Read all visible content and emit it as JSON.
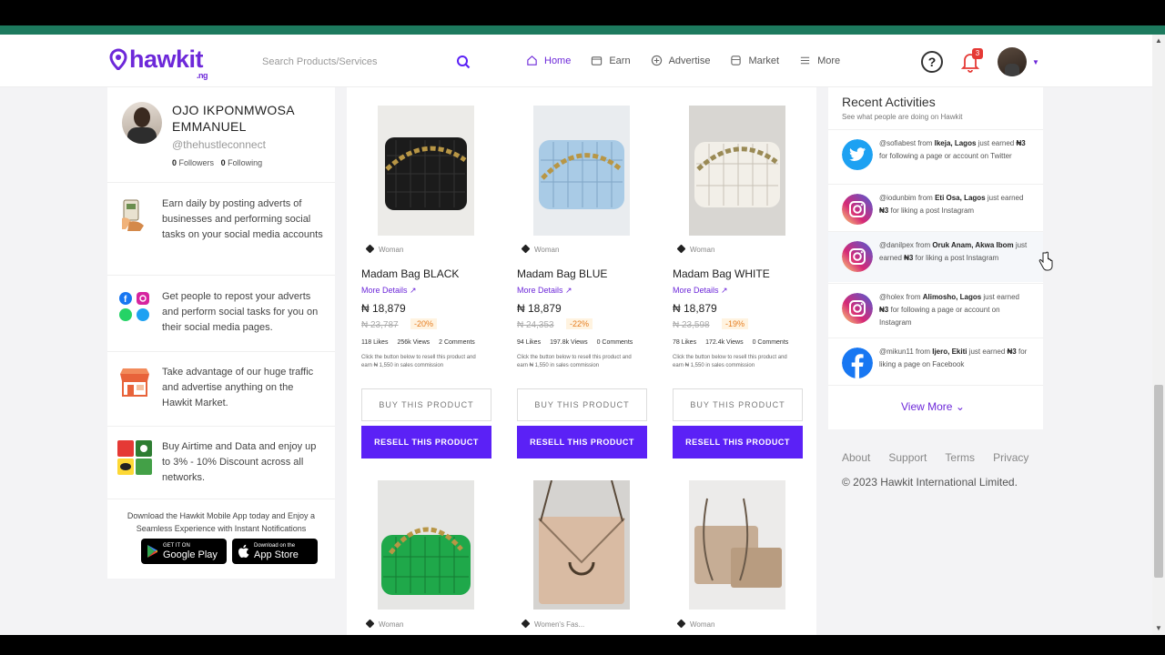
{
  "header": {
    "logo_text": "hawkit",
    "logo_suffix": ".ng",
    "search_placeholder": "Search Products/Services",
    "nav": [
      {
        "label": "Home",
        "icon": "home-icon"
      },
      {
        "label": "Earn",
        "icon": "wallet-icon"
      },
      {
        "label": "Advertise",
        "icon": "plus-circle-icon"
      },
      {
        "label": "Market",
        "icon": "store-icon"
      },
      {
        "label": "More",
        "icon": "menu-icon"
      }
    ],
    "help_label": "?",
    "notification_count": "3"
  },
  "profile": {
    "name": "OJO IKPONMWOSA EMMANUEL",
    "handle": "@thehustleconnect",
    "followers": "0",
    "followers_label": "Followers",
    "following": "0",
    "following_label": "Following"
  },
  "features": [
    {
      "text": "Earn daily by posting adverts of businesses and performing social tasks on your social media accounts",
      "icon": "money-hand-icon"
    },
    {
      "text": "Get people to repost your adverts and perform social tasks for you on their social media pages.",
      "icon": "social-icons"
    },
    {
      "text": "Take advantage of our huge traffic and advertise anything on the Hawkit Market.",
      "icon": "shop-icon"
    },
    {
      "text": "Buy Airtime and Data and enjoy up to 3% - 10% Discount across all networks.",
      "icon": "network-logos-icon"
    }
  ],
  "download": {
    "text": "Download the Hawkit Mobile App today and Enjoy a Seamless Experience with Instant Notifications",
    "google_small": "GET IT ON",
    "google_large": "Google Play",
    "apple_small": "Download on the",
    "apple_large": "App Store"
  },
  "product_labels": {
    "more_details": "More Details",
    "buy": "BUY THIS PRODUCT",
    "resell": "RESELL THIS PRODUCT",
    "note": "Click the button below to resell this product and earn ₦ 1,550 in sales commission"
  },
  "products": [
    {
      "category": "Woman",
      "title": "Madam Bag BLACK",
      "price": "₦ 18,879",
      "old_price": "₦ 23,787",
      "discount": "-20%",
      "likes": "118 Likes",
      "views": "256k Views",
      "comments": "2 Comments",
      "color": "#1b1b1b"
    },
    {
      "category": "Woman",
      "title": "Madam Bag BLUE",
      "price": "₦ 18,879",
      "old_price": "₦ 24,353",
      "discount": "-22%",
      "likes": "94 Likes",
      "views": "197.8k Views",
      "comments": "0 Comments",
      "color": "#a9cbe6"
    },
    {
      "category": "Woman",
      "title": "Madam Bag WHITE",
      "price": "₦ 18,879",
      "old_price": "₦ 23,598",
      "discount": "-19%",
      "likes": "78 Likes",
      "views": "172.4k Views",
      "comments": "0 Comments",
      "color": "#f2efe8"
    },
    {
      "category": "Woman",
      "color": "#1fa84a"
    },
    {
      "category": "Women's Fas...",
      "color": "#d9bba3"
    },
    {
      "category": "Woman",
      "color": "#c6ad95"
    }
  ],
  "recent": {
    "title": "Recent Activities",
    "subtitle": "See what people are doing on Hawkit",
    "items": [
      {
        "user": "@sofiabest",
        "from": "from",
        "location": "Ikeja, Lagos",
        "rest": "just earned",
        "amount": "₦3",
        "action": "for following a page or account on Twitter",
        "icon": "twitter-icon"
      },
      {
        "user": "@iodunbim",
        "from": "from",
        "location": "Eti Osa, Lagos",
        "rest": "just earned",
        "amount": "₦3",
        "action": "for liking a post Instagram",
        "icon": "instagram-icon"
      },
      {
        "user": "@danilpex",
        "from": "from",
        "location": "Oruk Anam, Akwa Ibom",
        "rest": "just earned",
        "amount": "₦3",
        "action": "for liking a post Instagram",
        "icon": "instagram-icon"
      },
      {
        "user": "@holex",
        "from": "from",
        "location": "Alimosho, Lagos",
        "rest": "just earned",
        "amount": "₦3",
        "action": "for following a page or account on Instagram",
        "icon": "instagram-icon"
      },
      {
        "user": "@mikun11",
        "from": "from",
        "location": "Ijero, Ekiti",
        "rest": "just earned",
        "amount": "₦3",
        "action": "for liking a page on Facebook",
        "icon": "facebook-icon"
      }
    ],
    "view_more": "View More"
  },
  "footer": {
    "links": [
      "About",
      "Support",
      "Terms",
      "Privacy"
    ],
    "copyright": "© 2023 Hawkit International Limited."
  },
  "colors": {
    "brand": "#6d28d9",
    "button": "#5b21f6",
    "top_strip": "#1d7a5e"
  }
}
